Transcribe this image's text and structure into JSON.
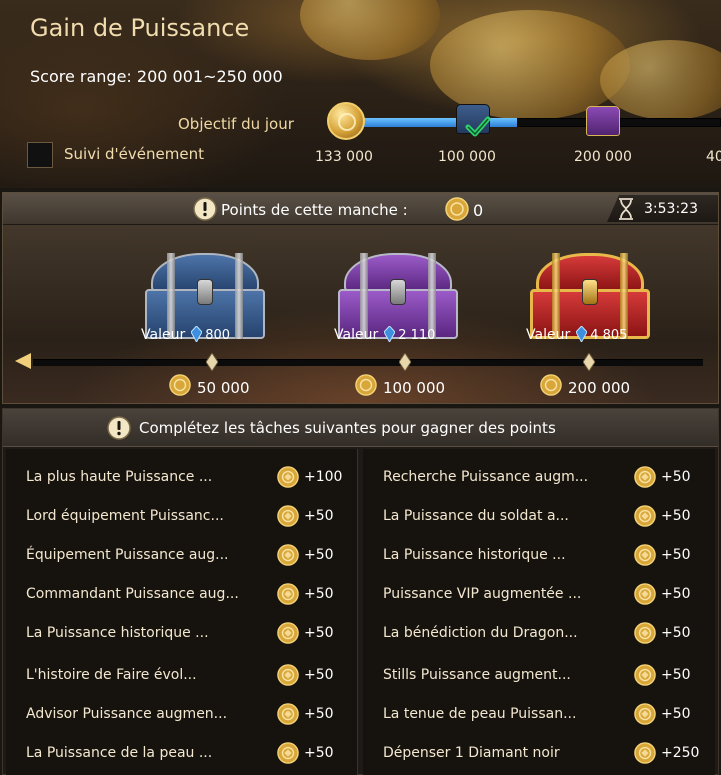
{
  "header": {
    "title": "Gain de Puissance",
    "score_range": "Score range: 200 001~250 000",
    "objective_label": "Objectif du jour",
    "follow_label": "Suivi d'événement",
    "daily_progress": 0.45,
    "milestones": [
      "133 000",
      "100 000",
      "200 000",
      "40"
    ]
  },
  "round": {
    "points_label": "Points de cette manche :",
    "points_value": "0",
    "timer": "3:53:23",
    "value_label": "Valeur",
    "chests": [
      {
        "color": "blue",
        "value": "800",
        "threshold": "50 000"
      },
      {
        "color": "purple",
        "value": "2 110",
        "threshold": "100 000"
      },
      {
        "color": "red",
        "value": "4 805",
        "threshold": "200 000"
      }
    ],
    "round_progress": 0.0
  },
  "tasks": {
    "header": "Complétez les tâches suivantes pour gagner des points",
    "left": [
      {
        "label": "La plus haute Puissance ...",
        "points": "+100"
      },
      {
        "label": "Lord équipement Puissanc...",
        "points": "+50"
      },
      {
        "label": "Équipement Puissance aug...",
        "points": "+50"
      },
      {
        "label": "Commandant Puissance aug...",
        "points": "+50"
      },
      {
        "label": "La Puissance historique ...",
        "points": "+50"
      },
      {
        "label": "L'histoire de Faire évol...",
        "points": "+50"
      },
      {
        "label": "Advisor Puissance augmen...",
        "points": "+50"
      },
      {
        "label": "La Puissance de la peau ...",
        "points": "+50"
      }
    ],
    "right": [
      {
        "label": "Recherche Puissance augm...",
        "points": "+50"
      },
      {
        "label": "La Puissance du soldat a...",
        "points": "+50"
      },
      {
        "label": "La Puissance historique ...",
        "points": "+50"
      },
      {
        "label": "Puissance VIP augmentée ...",
        "points": "+50"
      },
      {
        "label": "La bénédiction du Dragon...",
        "points": "+50"
      },
      {
        "label": "Stills Puissance augment...",
        "points": "+50"
      },
      {
        "label": "La tenue de peau Puissan...",
        "points": "+50"
      },
      {
        "label": "Dépenser 1 Diamant noir",
        "points": "+250"
      }
    ]
  },
  "colors": {
    "accent_gold": "#f1dcae",
    "progress_blue": "#2c7fd6",
    "coin_gold": "#d6a238"
  }
}
